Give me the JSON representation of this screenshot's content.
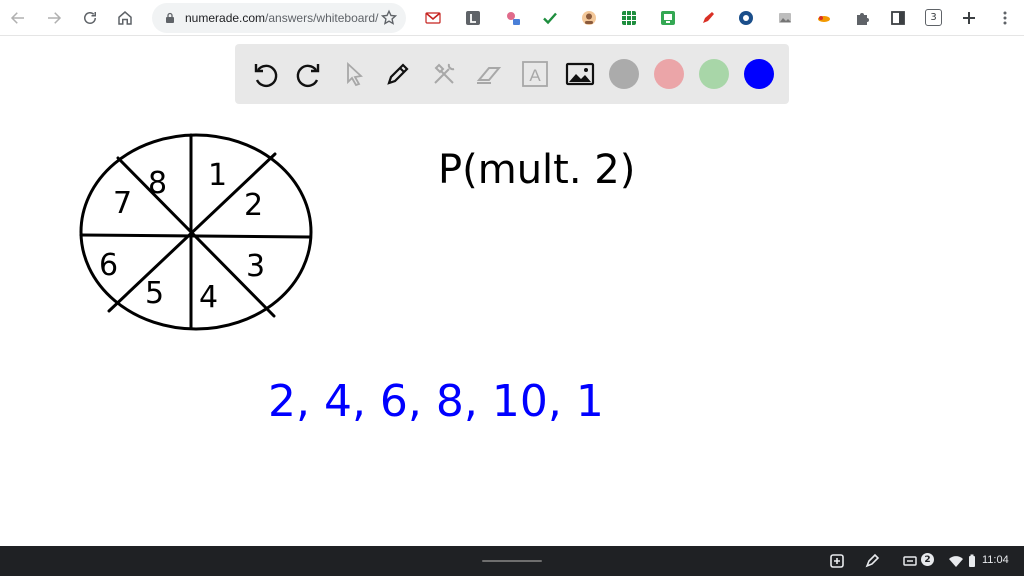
{
  "browser": {
    "url_host": "numerade.com",
    "url_path": "/answers/whiteboard/",
    "tab_count": "3",
    "extensions": [
      "gmail-icon",
      "l-extension-icon",
      "puzzle-badge-icon",
      "check-icon",
      "avatar-extension-icon",
      "grid-extension-icon",
      "screen-extension-icon",
      "pen-extension-icon",
      "circle-extension-icon",
      "photo-extension-icon",
      "fire-extension-icon"
    ]
  },
  "whiteboard": {
    "tools": [
      "undo",
      "redo",
      "select",
      "pen",
      "tools",
      "eraser",
      "text",
      "image"
    ],
    "text_tool_label": "A",
    "colors": [
      "#ababab",
      "#eba5a8",
      "#a8d6a8",
      "#0000ff"
    ],
    "selected_color": "#0000ff",
    "handwriting": {
      "spinner_numbers": [
        "8",
        "1",
        "2",
        "3",
        "4",
        "5",
        "6",
        "7"
      ],
      "question": "P(mult. 2)",
      "answer_sequence": "2, 4, 6, 8, 10, 1"
    }
  },
  "shelf": {
    "notification_count": "2",
    "time": "11:04"
  }
}
